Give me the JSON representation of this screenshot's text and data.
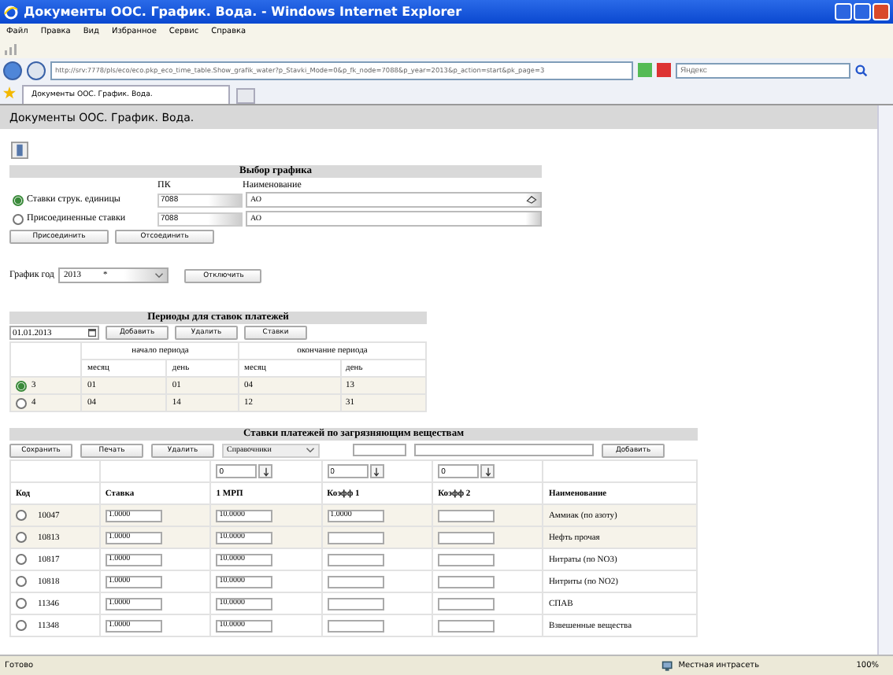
{
  "window": {
    "title": "Документы ООС. График. Вода. - Windows Internet Explorer"
  },
  "menu": [
    "Файл",
    "Правка",
    "Вид",
    "Избранное",
    "Сервис",
    "Справка"
  ],
  "address_bar": {
    "url": "http://srv:7778/pls/eco/eco.pkp_eco_time_table.Show_grafik_water?p_Stavki_Mode=0&p_fk_node=7088&p_year=2013&p_action=start&pk_page=3"
  },
  "search": {
    "placeholder": "Яндекс"
  },
  "tabs": [
    {
      "label": "Документы ООС. График. Вода.",
      "selected": true
    }
  ],
  "page": {
    "title": "Документы ООС. График. Вода."
  },
  "schedule_choice": {
    "title": "Выбор графика",
    "columns": [
      "ПК",
      "Наименование"
    ],
    "options": [
      {
        "label": "Ставки струк. единицы",
        "selected": true,
        "pk": "7088",
        "name": "АО"
      },
      {
        "label": "Присоединенные ставки",
        "selected": false,
        "pk": "7088",
        "name": "АО"
      }
    ],
    "buttons": [
      "Присоединить",
      "Отсоединить"
    ],
    "year_label": "График год",
    "year": "2013",
    "year_mark": "*",
    "disable_button": "Отключить"
  },
  "periods": {
    "title": "Периоды для ставок платежей",
    "date": "01.01.2013",
    "buttons": [
      "Добавить",
      "Удалить",
      "Ставки"
    ],
    "group_headers": [
      "начало периода",
      "окончание периода"
    ],
    "columns": [
      "месяц",
      "день",
      "месяц",
      "день"
    ],
    "rows": [
      {
        "label": "3",
        "selected": true,
        "cells": [
          "01",
          "01",
          "04",
          "13"
        ]
      },
      {
        "label": "4",
        "selected": false,
        "cells": [
          "04",
          "14",
          "12",
          "31"
        ]
      }
    ]
  },
  "rates": {
    "title": "Ставки платежей по загрязняющим веществам",
    "buttons": [
      "Сохранить",
      "Печать",
      "Удалить"
    ],
    "dropdown": "Справочники",
    "add_button": "Добавить",
    "fill_values": [
      "0",
      "0",
      "0"
    ],
    "columns": [
      "Код",
      "Ставка",
      "1 МРП",
      "Коэфф 1",
      "Коэфф 2",
      "Наименование"
    ],
    "rows": [
      {
        "code": "10047",
        "selected": false,
        "rate": "1.0000",
        "mrp": "10.0000",
        "k1": "1.0000",
        "name": "Аммиак (по азоту)"
      },
      {
        "code": "10813",
        "selected": false,
        "rate": "1.0000",
        "mrp": "10.0000",
        "name": "Нефть прочая"
      },
      {
        "code": "10817",
        "selected": false,
        "rate": "1.0000",
        "mrp": "10.0000",
        "name": "Нитраты (по NO3)"
      },
      {
        "code": "10818",
        "selected": false,
        "rate": "1.0000",
        "mrp": "10.0000",
        "name": "Нитриты (по NO2)"
      },
      {
        "code": "11346",
        "selected": false,
        "rate": "1.0000",
        "mrp": "10.0000",
        "name": "СПАВ"
      },
      {
        "code": "11348",
        "selected": false,
        "rate": "1.0000",
        "mrp": "10.0000",
        "name": "Взвешенные вещества"
      }
    ]
  },
  "status_bar": {
    "text": "Готово",
    "zone": "Местная интрасеть",
    "zoom": "100%"
  }
}
